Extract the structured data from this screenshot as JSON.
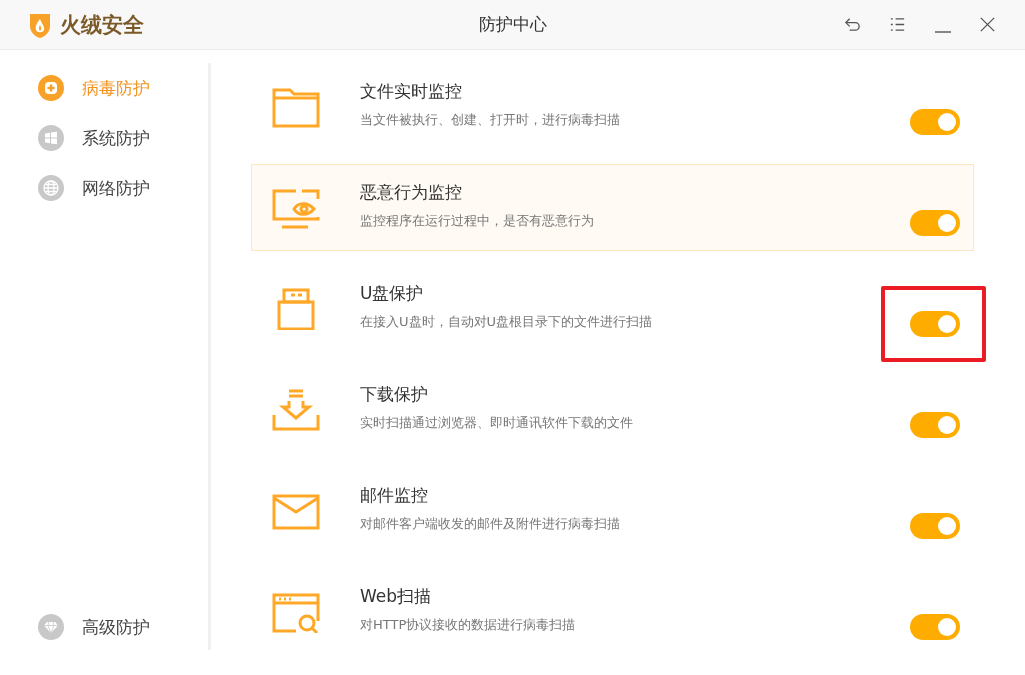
{
  "window": {
    "app_name": "火绒安全",
    "title": "防护中心"
  },
  "sidebar": {
    "items": [
      {
        "label": "病毒防护",
        "selected": true
      },
      {
        "label": "系统防护",
        "selected": false
      },
      {
        "label": "网络防护",
        "selected": false
      }
    ],
    "bottom_items": [
      {
        "label": "高级防护",
        "selected": false
      }
    ]
  },
  "features": [
    {
      "title": "文件实时监控",
      "description": "当文件被执行、创建、打开时，进行病毒扫描",
      "on": true,
      "highlighted": false,
      "annotated": false
    },
    {
      "title": "恶意行为监控",
      "description": "监控程序在运行过程中，是否有恶意行为",
      "on": true,
      "highlighted": true,
      "annotated": false
    },
    {
      "title": "U盘保护",
      "description": "在接入U盘时，自动对U盘根目录下的文件进行扫描",
      "on": true,
      "highlighted": false,
      "annotated": true
    },
    {
      "title": "下载保护",
      "description": "实时扫描通过浏览器、即时通讯软件下载的文件",
      "on": true,
      "highlighted": false,
      "annotated": false
    },
    {
      "title": "邮件监控",
      "description": "对邮件客户端收发的邮件及附件进行病毒扫描",
      "on": true,
      "highlighted": false,
      "annotated": false
    },
    {
      "title": "Web扫描",
      "description": "对HTTP协议接收的数据进行病毒扫描",
      "on": true,
      "highlighted": false,
      "annotated": false
    }
  ]
}
